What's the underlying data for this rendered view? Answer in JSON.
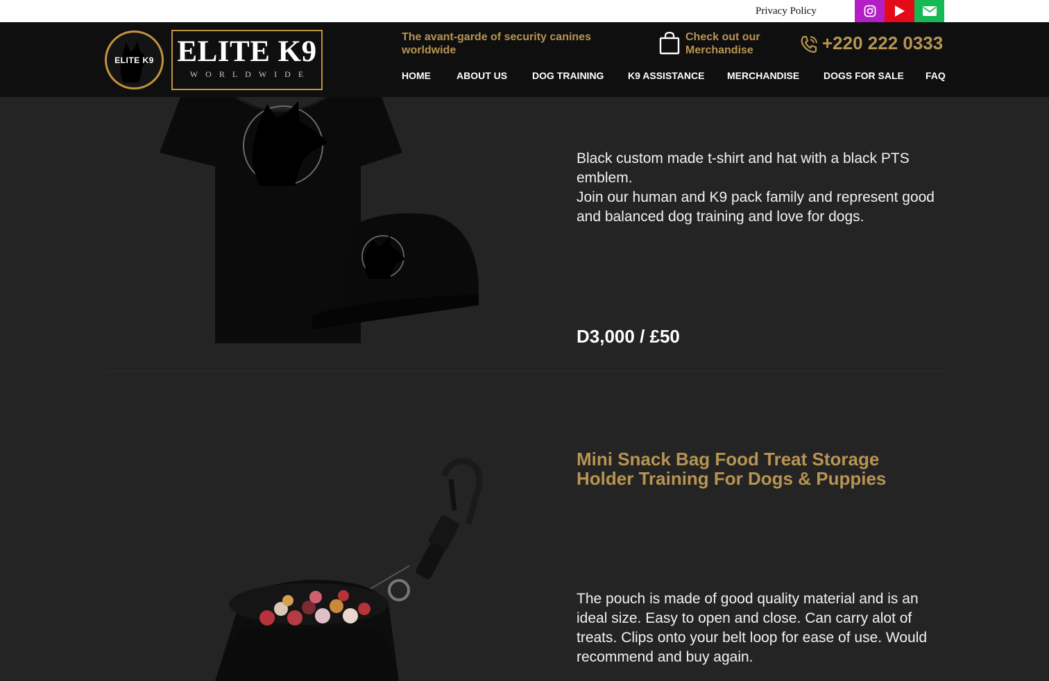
{
  "topbar": {
    "privacy_label": "Privacy Policy",
    "social": [
      {
        "name": "instagram-icon",
        "color": "#b31ec6"
      },
      {
        "name": "youtube-icon",
        "color": "#e30b17"
      },
      {
        "name": "email-icon",
        "color": "#16b955"
      }
    ]
  },
  "header": {
    "logo_circle_text": "ELITE K9",
    "logo_title": "ELITE K9",
    "logo_subtitle": "WORLDWIDE",
    "tagline": "The avant-garde of security canines worldwide",
    "merch_link": "Check out our Merchandise",
    "phone": "+220 222 0333",
    "nav": [
      "HOME",
      "ABOUT US",
      "DOG TRAINING",
      "K9 ASSISTANCE",
      "MERCHANDISE",
      "DOGS FOR SALE",
      "FAQ"
    ]
  },
  "colors": {
    "accent_gold": "#b89452",
    "header_bg": "#0f0f0f",
    "page_bg": "#242424"
  },
  "products": [
    {
      "image": "tshirt-and-cap-image",
      "description": "Black custom made t-shirt and hat with a black PTS emblem.\nJoin our human and K9 pack family and represent good and balanced dog training and love for dogs.",
      "price": "D3,000 / £50"
    },
    {
      "image": "snack-bag-image",
      "title": "Mini Snack Bag Food Treat Storage Holder Training For Dogs & Puppies",
      "description": "The pouch is made of good quality material and is an ideal size. Easy to open and close. Can carry alot of treats. Clips onto your belt loop for ease of use. Would recommend and buy again."
    }
  ]
}
